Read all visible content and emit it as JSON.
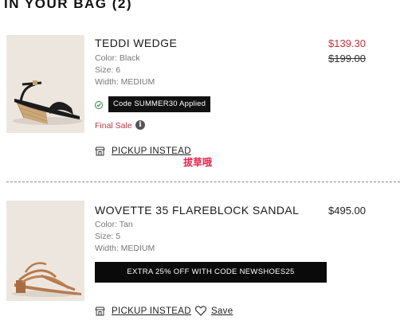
{
  "bag": {
    "title": "IN YOUR BAG (2)"
  },
  "items": [
    {
      "name": "TEDDI WEDGE",
      "color": "Color: Black",
      "size": "Size: 6",
      "width": "Width: MEDIUM",
      "sale_price": "$139.30",
      "original_price": "$199.00",
      "promo_code_label": "Code SUMMER30 Applied",
      "final_sale_label": "Final Sale",
      "info_icon": "i",
      "pickup_label": "PICKUP INSTEAD",
      "annotation": "拔草哦"
    },
    {
      "name": "WOVETTE 35 FLAREBLOCK SANDAL",
      "color": "Color: Tan",
      "size": "Size: 5",
      "width": "Width: MEDIUM",
      "price": "$495.00",
      "promo_banner": "EXTRA 25% OFF WITH CODE NEWSHOES25",
      "pickup_label": "PICKUP INSTEAD",
      "save_label": "Save"
    }
  ],
  "colors": {
    "sale_red": "#c8323c",
    "check_green": "#2d8a47",
    "annotation_pink": "#e8214a",
    "thumb_bg": "#ede6df"
  },
  "icons": [
    "store-icon",
    "check-circle-icon",
    "info-icon",
    "heart-icon"
  ]
}
